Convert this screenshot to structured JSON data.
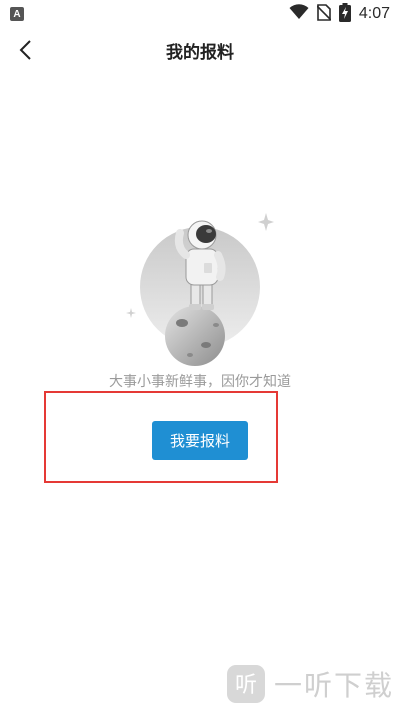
{
  "status_bar": {
    "time": "4:07",
    "app_badge": "A",
    "icons": [
      "wifi-icon",
      "no-sim-icon",
      "battery-charging-icon"
    ]
  },
  "header": {
    "title": "我的报料",
    "back_icon": "chevron-left-icon"
  },
  "empty_state": {
    "illustration": "astronaut-on-planet",
    "message": "大事小事新鲜事，因你才知道",
    "button_label": "我要报料"
  },
  "watermark": {
    "logo_char": "听",
    "text": "一听下载"
  },
  "colors": {
    "button": "#1f8fd3",
    "highlight_border": "#e53935",
    "message_text": "#9a9a9a"
  }
}
